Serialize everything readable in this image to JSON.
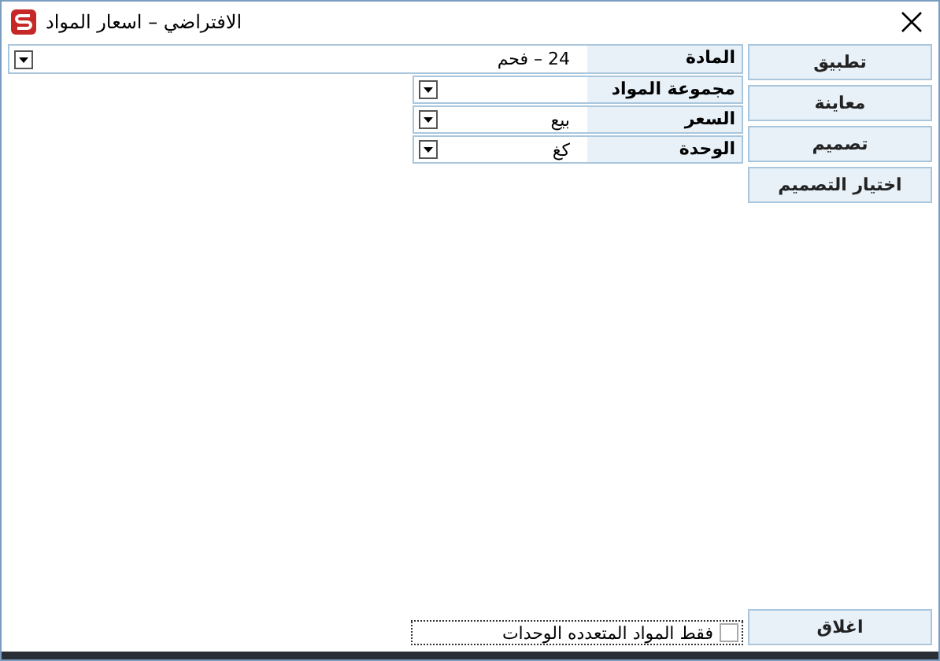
{
  "window": {
    "title": "الافتراضي – اسعار المواد"
  },
  "fields": [
    {
      "label": "المادة",
      "value": "24 – فحم",
      "wide": true
    },
    {
      "label": "مجموعة المواد",
      "wide": false
    },
    {
      "label": "السعر",
      "value": "بيع",
      "wide": false
    },
    {
      "label": "الوحدة",
      "value": "كغ",
      "wide": false
    }
  ],
  "buttons": [
    "تطبيق",
    "معاينة",
    "تصميم",
    "اختيار التصميم"
  ],
  "option": {
    "label": "فقط المواد المتعدده الوحدات",
    "checked": false
  },
  "close_button": "اغلاق"
}
